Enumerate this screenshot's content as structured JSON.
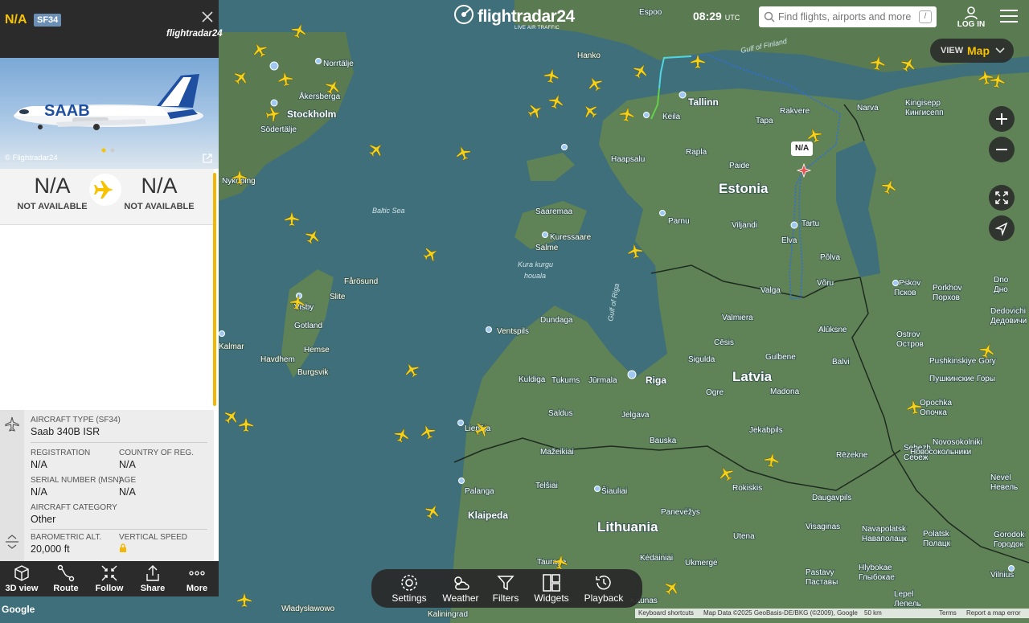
{
  "app": {
    "brand": "flightradar24",
    "brand_sub": "LIVE AIR TRAFFIC"
  },
  "header": {
    "time": "08:29",
    "time_zone": "UTC",
    "search_placeholder": "Find flights, airports and more",
    "search_shortcut": "/",
    "login_label": "LOG IN"
  },
  "view": {
    "label": "VIEW",
    "value": "Map"
  },
  "map": {
    "countries": [
      "Estonia",
      "Latvia",
      "Lithuania"
    ],
    "waters": [
      "Baltic Sea",
      "Gulf of Finland",
      "Gulf of Riga",
      "Kura kurgu",
      "houala"
    ],
    "cities": [
      "Stockholm",
      "Tallinn",
      "Riga",
      "Tartu",
      "Narva",
      "Parnu",
      "Haapsalu",
      "Keila",
      "Rapla",
      "Paide",
      "Viljandi",
      "Elva",
      "Valga",
      "Võru",
      "Põlva",
      "Rakvere",
      "Tapa",
      "Kingisepp",
      "Кингисепп",
      "Hanko",
      "Espoo",
      "Norrtälje",
      "Åkersberga",
      "Södertälje",
      "Nyköping",
      "Saaremaa",
      "Kuressaare",
      "Salme",
      "Ventspils",
      "Dundaga",
      "Kuldiga",
      "Tukums",
      "Jūrmala",
      "Liepāja",
      "Saldus",
      "Jelgava",
      "Bauska",
      "Mažeikiai",
      "Telšiai",
      "Šiauliai",
      "Palanga",
      "Klaipeda",
      "Panevėžys",
      "Kėdainiai",
      "Ukmergė",
      "Utena",
      "Daugavpils",
      "Rēzekne",
      "Jekabpils",
      "Gulbene",
      "Madona",
      "Balvi",
      "Alūksne",
      "Valmiera",
      "Cēsis",
      "Sigulda",
      "Ogre",
      "Rokiskis",
      "Visaginas",
      "Pskov",
      "Псков",
      "Ostrov",
      "Остров",
      "Porkhov",
      "Порхов",
      "Pushkinskiye Gory",
      "Пушкинские Горы",
      "Opochka",
      "Опочка",
      "Sebezh",
      "Себеж",
      "Novosokolniki",
      "Новосокольники",
      "Nevel",
      "Невель",
      "Polatsk",
      "Полацк",
      "Navapolatsk",
      "Наваполацк",
      "Hlybokae",
      "Глыбокае",
      "Pastavy",
      "Паставы",
      "Lepel",
      "Лепель",
      "Gorodok",
      "Городок",
      "Dno",
      "Дно",
      "Dedovichi",
      "Дедовичи",
      "Visby",
      "Gotland",
      "Fårösund",
      "Slite",
      "Hemse",
      "Havdhem",
      "Burgsvik",
      "Kalmar",
      "Kaliningrad",
      "Taurage",
      "Kaunas",
      "Władysławowo",
      "Vilnius"
    ],
    "selected_tag": "N/A",
    "attribution": {
      "shortcuts": "Keyboard shortcuts",
      "data": "Map Data ©2025 GeoBasis-DE/BKG (©2009), Google",
      "scale": "50 km",
      "terms": "Terms",
      "report": "Report a map error"
    },
    "google": "Google"
  },
  "panel": {
    "callsign": "N/A",
    "type_code": "SF34",
    "brand": "flightradar24",
    "photo_credit": "© Flightradar24",
    "origin_code": "N/A",
    "origin_name": "NOT AVAILABLE",
    "dest_code": "N/A",
    "dest_name": "NOT AVAILABLE",
    "aircraft_type_label": "AIRCRAFT TYPE",
    "aircraft_type_code": "(SF34)",
    "aircraft_type": "Saab 340B ISR",
    "registration_label": "REGISTRATION",
    "registration": "N/A",
    "country_label": "COUNTRY OF REG.",
    "country": "N/A",
    "msn_label": "SERIAL NUMBER (MSN)",
    "msn": "N/A",
    "age_label": "AGE",
    "age": "N/A",
    "category_label": "AIRCRAFT CATEGORY",
    "category": "Other",
    "baro_label": "BAROMETRIC ALT.",
    "baro_alt": "20,000 ft",
    "vs_label": "VERTICAL SPEED"
  },
  "panel_actions": [
    "3D view",
    "Route",
    "Follow",
    "Share",
    "More"
  ],
  "toolbar": [
    "Settings",
    "Weather",
    "Filters",
    "Widgets",
    "Playback"
  ],
  "colors": {
    "accent": "#f7c300",
    "panel_dark": "#2b2b2b",
    "track": "#2f6fe0",
    "badge": "#6b8fb5"
  }
}
